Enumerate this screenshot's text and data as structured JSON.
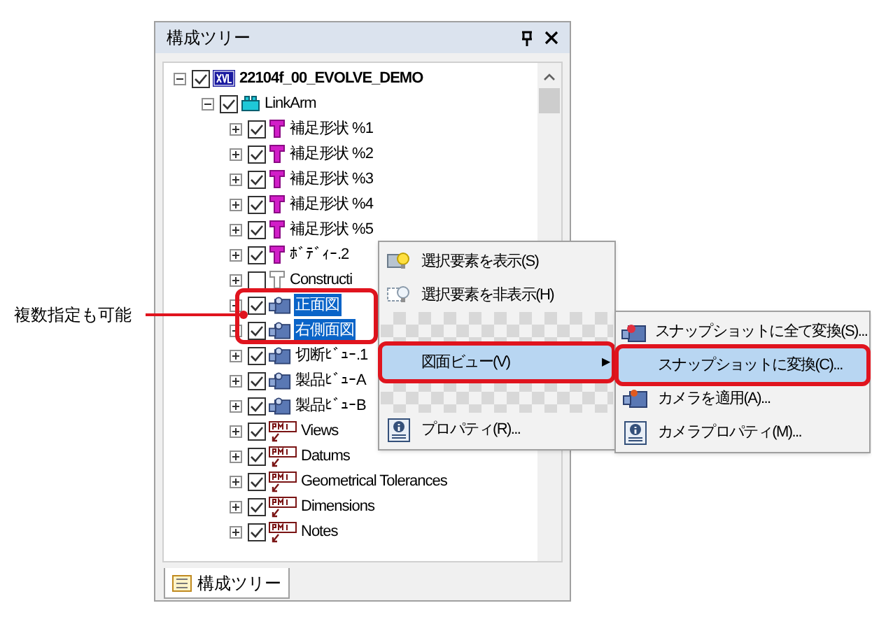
{
  "panel": {
    "title": "構成ツリー",
    "tab": {
      "label": "構成ツリー",
      "selected": true
    }
  },
  "tree": [
    {
      "label": "22104f_00_EVOLVE_DEMO",
      "kind": "xvl",
      "checked": true,
      "expanded": true,
      "selected": false,
      "children": [
        {
          "label": "LinkArm",
          "kind": "assembly",
          "checked": true,
          "expanded": true,
          "selected": false,
          "children": [
            {
              "label": "補足形状 %1",
              "kind": "shape",
              "checked": true,
              "expanded": false,
              "selected": false
            },
            {
              "label": "補足形状 %2",
              "kind": "shape",
              "checked": true,
              "expanded": false,
              "selected": false
            },
            {
              "label": "補足形状 %3",
              "kind": "shape",
              "checked": true,
              "expanded": false,
              "selected": false
            },
            {
              "label": "補足形状 %4",
              "kind": "shape",
              "checked": true,
              "expanded": false,
              "selected": false
            },
            {
              "label": "補足形状 %5",
              "kind": "shape",
              "checked": true,
              "expanded": false,
              "selected": false
            },
            {
              "label": "ﾎﾞﾃﾞｨｰ.2",
              "kind": "shape",
              "checked": true,
              "expanded": false,
              "selected": false
            },
            {
              "label": "Constructi",
              "kind": "shape-outline",
              "checked": false,
              "expanded": false,
              "selected": false
            },
            {
              "label": "正面図",
              "kind": "camera",
              "checked": true,
              "expanded": false,
              "selected": true
            },
            {
              "label": "右側面図",
              "kind": "camera",
              "checked": true,
              "expanded": false,
              "selected": true
            },
            {
              "label": "切断ﾋﾞｭｰ.1",
              "kind": "camera",
              "checked": true,
              "expanded": false,
              "selected": false
            },
            {
              "label": "製品ﾋﾞｭｰA",
              "kind": "camera",
              "checked": true,
              "expanded": false,
              "selected": false
            },
            {
              "label": "製品ﾋﾞｭｰB",
              "kind": "camera",
              "checked": true,
              "expanded": false,
              "selected": false
            },
            {
              "label": "Views",
              "kind": "pmi",
              "checked": true,
              "expanded": false,
              "selected": false
            },
            {
              "label": "Datums",
              "kind": "pmi",
              "checked": true,
              "expanded": false,
              "selected": false
            },
            {
              "label": "Geometrical Tolerances",
              "kind": "pmi",
              "checked": true,
              "expanded": false,
              "selected": false
            },
            {
              "label": "Dimensions",
              "kind": "pmi",
              "checked": true,
              "expanded": false,
              "selected": false
            },
            {
              "label": "Notes",
              "kind": "pmi",
              "checked": true,
              "expanded": false,
              "selected": false
            }
          ]
        }
      ]
    }
  ],
  "context_menu": {
    "items": [
      {
        "kind": "show",
        "label": "選択要素を表示(S)",
        "selected": false,
        "highlighted": false
      },
      {
        "kind": "hide",
        "label": "選択要素を非表示(H)",
        "selected": false,
        "highlighted": false
      },
      {
        "kind": "gap"
      },
      {
        "kind": "submenu",
        "label": "図面ビュー(V)",
        "arrow": "▶",
        "selected": true,
        "highlighted": true
      },
      {
        "kind": "gap"
      },
      {
        "kind": "properties",
        "label": "プロパティ(R)...",
        "selected": false,
        "highlighted": false
      }
    ]
  },
  "submenu": {
    "items": [
      {
        "kind": "snapshot",
        "label": "スナップショットに全て変換(S)...",
        "selected": false,
        "highlighted": false
      },
      {
        "kind": "plain",
        "label": "スナップショットに変換(C)...",
        "selected": true,
        "highlighted": true
      },
      {
        "kind": "camera",
        "label": "カメラを適用(A)...",
        "selected": false,
        "highlighted": false
      },
      {
        "kind": "properties",
        "label": "カメラプロパティ(M)...",
        "selected": false,
        "highlighted": false
      }
    ]
  },
  "callout": {
    "text": "複数指定も可能"
  }
}
